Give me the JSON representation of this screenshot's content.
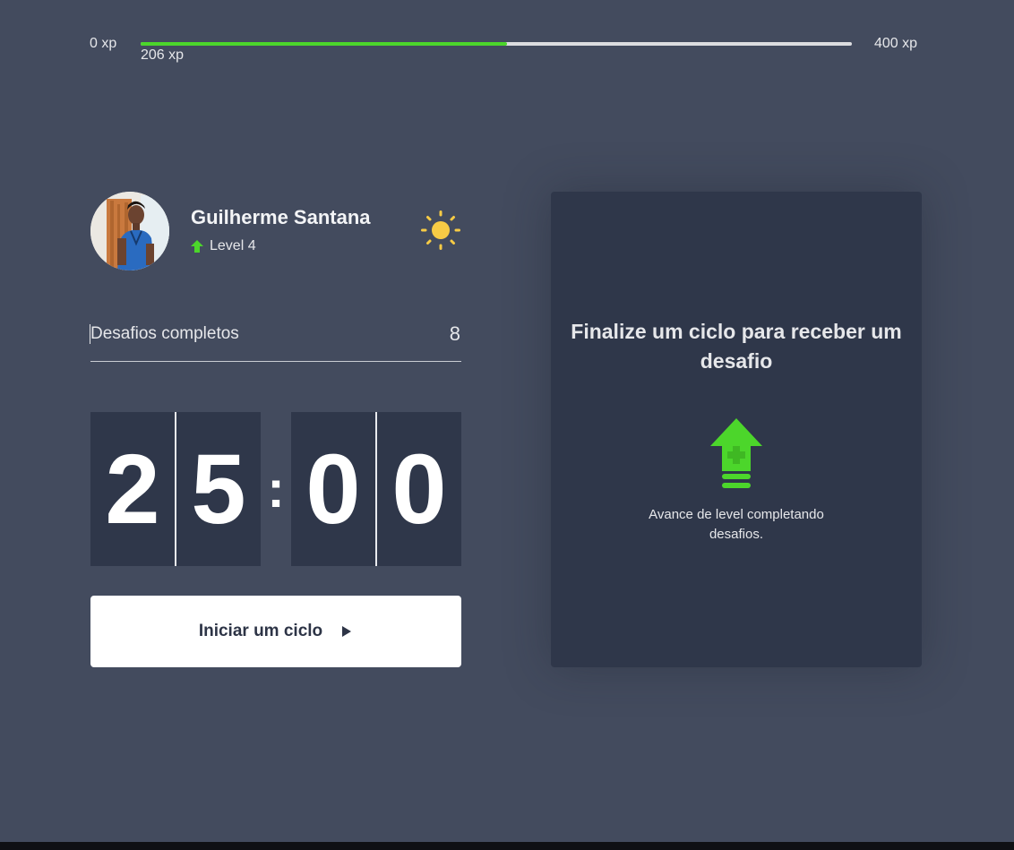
{
  "xp_bar": {
    "min_label": "0 xp",
    "max_label": "400 xp",
    "current_label": "206 xp",
    "progress_fraction": 0.515,
    "fill_color": "#4cd62b"
  },
  "profile": {
    "name": "Guilherme Santana",
    "level_label": "Level 4",
    "level_icon": "level-up-arrow-icon",
    "theme_toggle_icon": "sun-icon"
  },
  "challenges": {
    "label": "Desafios completos",
    "count": "8"
  },
  "countdown": {
    "minute_left": "2",
    "minute_right": "5",
    "separator": ":",
    "second_left": "0",
    "second_right": "0"
  },
  "start_button": {
    "label": "Iniciar um ciclo",
    "icon": "play-icon"
  },
  "challenge_panel": {
    "title": "Finalize um ciclo para receber um desafio",
    "icon": "level-up-icon",
    "text": "Avance de level completando desafios."
  },
  "colors": {
    "background": "#434b5e",
    "panel": "#2f374a",
    "accent_green": "#4cd62b",
    "sun": "#f7cb45"
  }
}
